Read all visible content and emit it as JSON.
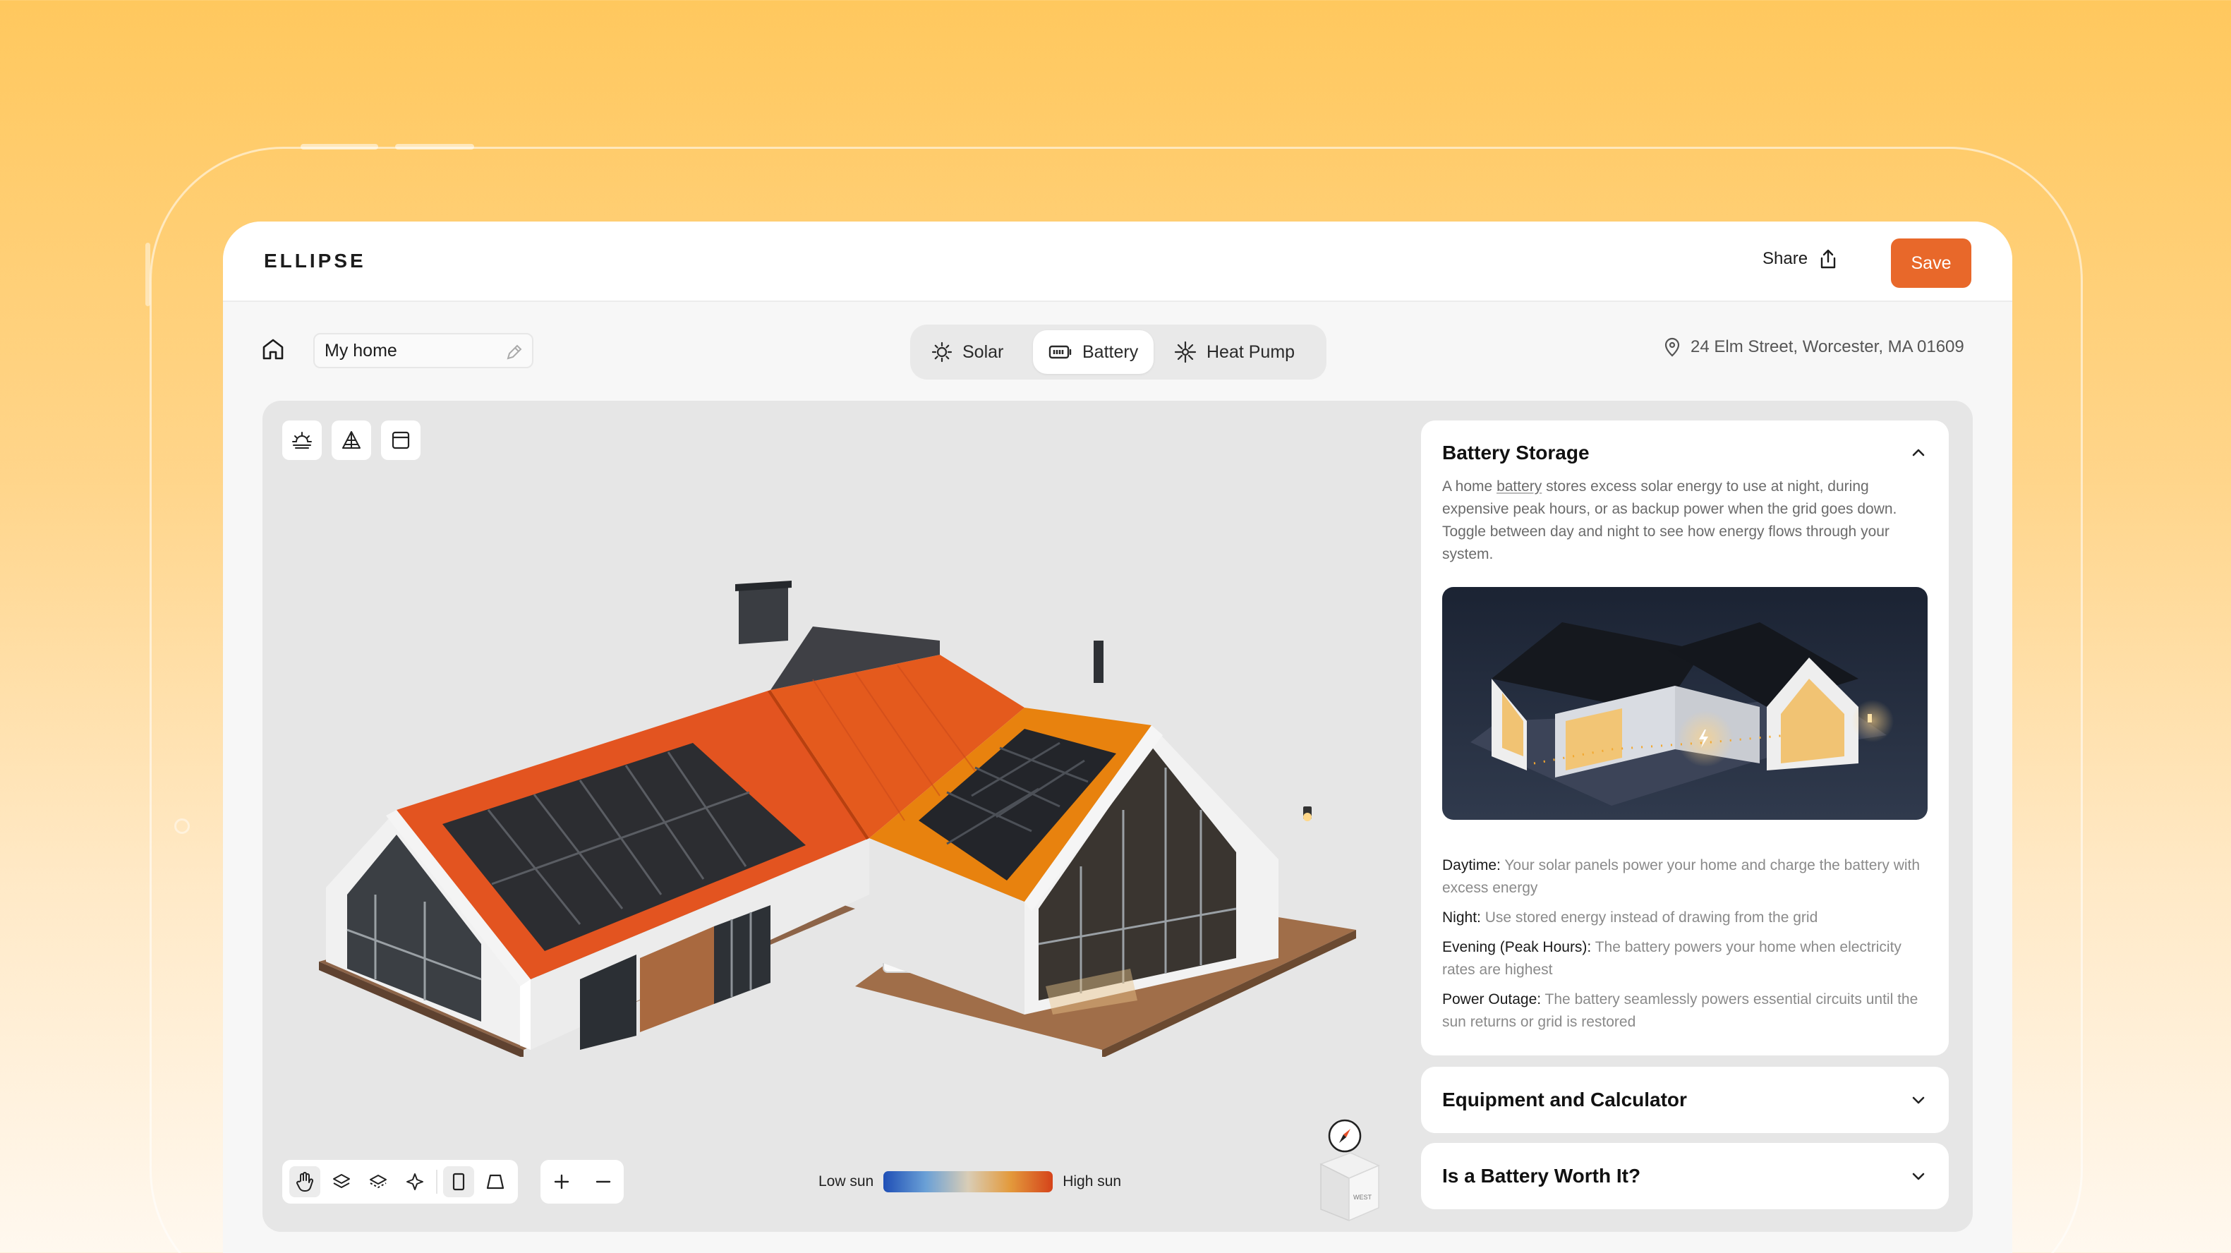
{
  "app": {
    "logo": "ELLIPSE"
  },
  "header": {
    "share_label": "Share",
    "save_label": "Save"
  },
  "project": {
    "name": "My home"
  },
  "tabs": [
    {
      "label": "Solar",
      "icon": "sun-icon",
      "active": false
    },
    {
      "label": "Battery",
      "icon": "battery-icon",
      "active": true
    },
    {
      "label": "Heat Pump",
      "icon": "snowflake-icon",
      "active": false
    }
  ],
  "location": {
    "address": "24 Elm Street, Worcester, MA 01609"
  },
  "viewer": {
    "top_tools": [
      "sun-path-icon",
      "terrain-icon",
      "calendar-icon"
    ],
    "bottom_tools": [
      "hand-icon",
      "layers-icon",
      "layers-alt-icon",
      "sparkle-icon",
      "portrait-icon",
      "perspective-icon"
    ],
    "legend": {
      "low": "Low sun",
      "high": "High sun"
    },
    "cube_labels": {
      "front": "WEST"
    }
  },
  "panel": {
    "battery_storage": {
      "title": "Battery Storage",
      "desc_pre": "A home ",
      "desc_link": "battery",
      "desc_post": " stores excess solar energy to use at night, during expensive peak hours, or as backup power when the grid goes down. Toggle between day and night to see how energy flows through your system.",
      "items": [
        {
          "term": "Daytime:",
          "text": " Your solar panels power your home and charge the battery with excess energy"
        },
        {
          "term": "Night:",
          "text": " Use stored energy instead of drawing from the grid"
        },
        {
          "term": "Evening (Peak Hours):",
          "text": " The battery powers your home when electricity rates are highest"
        },
        {
          "term": "Power Outage:",
          "text": " The battery seamlessly powers essential circuits until the sun returns or grid is restored"
        }
      ]
    },
    "equipment": {
      "title": "Equipment and Calculator"
    },
    "worth": {
      "title": "Is a Battery Worth It?"
    }
  },
  "colors": {
    "accent": "#e8682a",
    "roof": "#e35420",
    "roof_highlight": "#e8820e"
  }
}
